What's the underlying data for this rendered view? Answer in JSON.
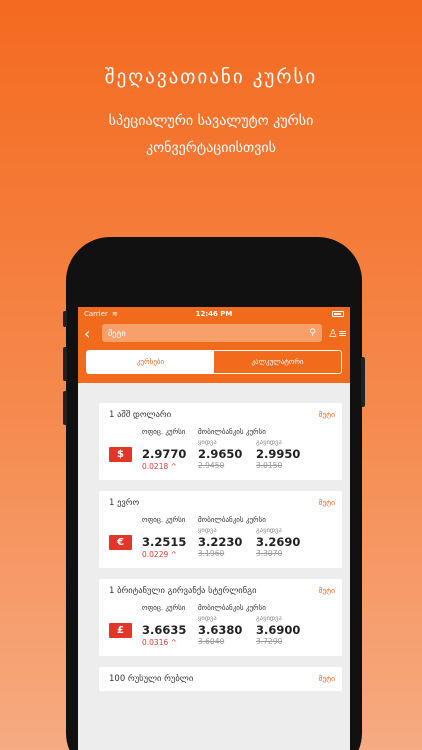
{
  "promo": {
    "headline": "შეღავათიანი კურსი",
    "line1": "სპეციალური სავალუტო კურსი",
    "line2": "კონვერტაციისთვის"
  },
  "status": {
    "carrier": "Carrier",
    "time": "12:46 PM"
  },
  "search": {
    "value": "მეტი"
  },
  "tabs": {
    "rates": "კურსები",
    "calculator": "კალკულატორი"
  },
  "colors": {
    "accent": "#f26a1b",
    "flag": "#e3362b",
    "negative": "#e53935"
  },
  "labels": {
    "official": "ოფიც. კურსი",
    "mobile_bank": "მობილბანკის კურსი",
    "buy": "ყიდვა",
    "sell": "გაყიდვა",
    "more": "მეტი"
  },
  "currencies": [
    {
      "name": "1 აშშ დოლარი",
      "symbol": "$",
      "official": "2.9770",
      "delta": "0.0218",
      "buy": "2.9650",
      "sell": "2.9950",
      "buy_old": "2.9450",
      "sell_old": "3.0150"
    },
    {
      "name": "1 ევრო",
      "symbol": "€",
      "official": "3.2515",
      "delta": "0.0229",
      "buy": "3.2230",
      "sell": "3.2690",
      "buy_old": "3.1960",
      "sell_old": "3.3070"
    },
    {
      "name": "1 ბრიტანული გირვანქა სტერლინგი",
      "symbol": "£",
      "official": "3.6635",
      "delta": "0.0316",
      "buy": "3.6380",
      "sell": "3.6900",
      "buy_old": "3.6040",
      "sell_old": "3.7290"
    },
    {
      "name": "100 რუსული რუბლი"
    }
  ],
  "tabbar": {
    "home": "home-icon",
    "layers": "layers-icon",
    "transfer": "transfer-icon",
    "rates": "rates-icon",
    "more": "more-icon"
  }
}
